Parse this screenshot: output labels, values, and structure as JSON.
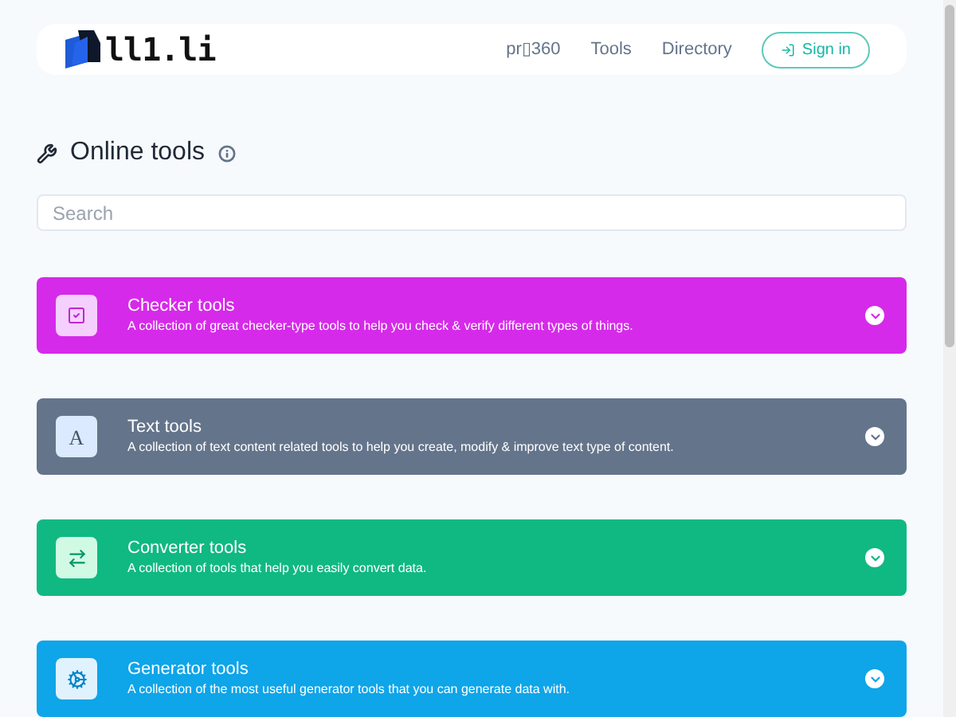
{
  "header": {
    "logo_text": "ll1.li",
    "nav": [
      "pr▯360",
      "Tools",
      "Directory"
    ],
    "sign_in": "Sign in"
  },
  "heading": {
    "title": "Online tools"
  },
  "search": {
    "placeholder": "Search"
  },
  "categories": [
    {
      "kind": "checker",
      "title": "Checker tools",
      "description": "A collection of great checker-type tools to help you check & verify different types of things.",
      "color": "#d62aea",
      "expanded": false
    },
    {
      "kind": "text",
      "title": "Text tools",
      "description": "A collection of text content related tools to help you create, modify & improve text type of content.",
      "icon_text": "A",
      "color": "#64748b",
      "expanded": false
    },
    {
      "kind": "converter",
      "title": "Converter tools",
      "description": "A collection of tools that help you easily convert data.",
      "color": "#10b981",
      "expanded": false
    },
    {
      "kind": "generator",
      "title": "Generator tools",
      "description": "A collection of the most useful generator tools that you can generate data with.",
      "color": "#0ea5e9",
      "expanded": false
    }
  ]
}
